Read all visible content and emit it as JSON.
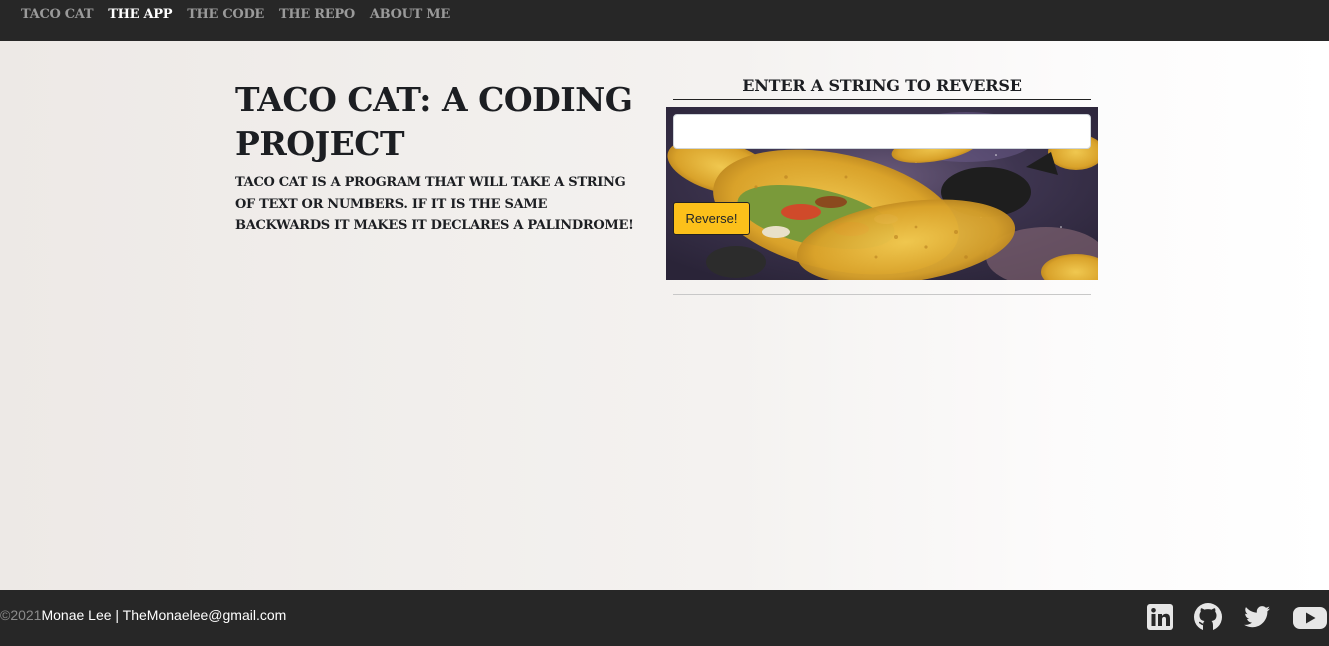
{
  "nav": {
    "items": [
      {
        "label": "TACO CAT",
        "active": false
      },
      {
        "label": "THE APP",
        "active": true
      },
      {
        "label": "THE CODE",
        "active": false
      },
      {
        "label": "THE REPO",
        "active": false
      },
      {
        "label": "ABOUT ME",
        "active": false
      }
    ]
  },
  "main": {
    "title": "TACO CAT: A CODING PROJECT",
    "description": "TACO CAT IS A PROGRAM THAT WILL TAKE A STRING OF TEXT OR NUMBERS. IF IT IS THE SAME BACKWARDS IT MAKES IT DECLARES A PALINDROME!"
  },
  "form": {
    "heading": "ENTER A STRING TO REVERSE",
    "input_value": "",
    "input_placeholder": "",
    "button_label": "Reverse!",
    "button_color": "#fcc01a"
  },
  "footer": {
    "copyright": "©2021",
    "contact": "Monae Lee | TheMonaelee@gmail.com",
    "social_icons": [
      "linkedin-icon",
      "github-icon",
      "twitter-icon",
      "youtube-icon"
    ]
  },
  "colors": {
    "nav_bg": "#272727",
    "nav_inactive": "#9a9a9a",
    "nav_active": "#ffffff",
    "accent": "#fcc01a"
  }
}
